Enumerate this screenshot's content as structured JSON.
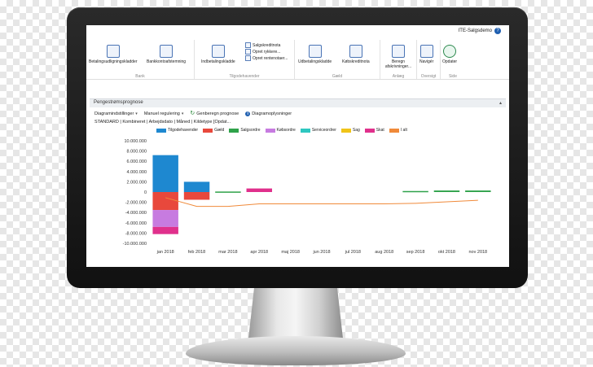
{
  "app": {
    "company": "ITE-Salgsdemo"
  },
  "ribbon": {
    "groups": [
      {
        "label": "Bank"
      },
      {
        "label": "Tilgodehavender"
      },
      {
        "label": "Gæld"
      },
      {
        "label": "Anlæg"
      },
      {
        "label": "Oversigt"
      },
      {
        "label": "Side"
      }
    ],
    "buttons": {
      "betalingsudligning": "Betalingsudligningskladder",
      "bankkonto": "Bankkontoafstemning",
      "indbetaling": "Indbetalingskladde",
      "salgskreditnota": "Salgskreditnota",
      "rykker": "Opret rykkere...",
      "rentenota": "Opret rentenotaer...",
      "udbetaling": "Udbetalingskladde",
      "kobskreditnota": "Købskreditnota",
      "beregn": "Beregn afskrivninger...",
      "naviger": "Navigér",
      "opdater": "Opdater"
    }
  },
  "part": {
    "title": "Pengestrømsprognose",
    "toolbar": {
      "diagramindstillinger": "Diagramindstillinger",
      "manuel": "Manuel regulering",
      "genberegn": "Genberegn prognose",
      "oplysninger": "Diagramoplysninger"
    },
    "filter": "STANDARD | Kombineret | Arbejdsdato | Måned | Kildetype [Opdat..."
  },
  "colors": {
    "accent": "#1f5fb0",
    "ribbon_icon": "#4a74b5"
  },
  "chart_data": {
    "type": "bar",
    "stacked": true,
    "categories": [
      "jan 2018",
      "feb 2018",
      "mar 2018",
      "apr 2018",
      "maj 2018",
      "jun 2018",
      "jul 2018",
      "aug 2018",
      "sep 2018",
      "okt 2018",
      "nov 2018"
    ],
    "ylim": [
      -10000000,
      10000000
    ],
    "yticks": [
      10000000,
      8000000,
      6000000,
      4000000,
      2000000,
      0,
      -2000000,
      -4000000,
      -6000000,
      -8000000,
      -10000000
    ],
    "ytick_labels": [
      "10.000.000",
      "8.000.000",
      "6.000.000",
      "4.000.000",
      "2.000.000",
      "0",
      "-2.000.000",
      "-4.000.000",
      "-6.000.000",
      "-8.000.000",
      "-10.000.000"
    ],
    "series": [
      {
        "name": "Tilgodehavender",
        "color": "#1e88d0",
        "values": [
          7200000,
          2000000,
          0,
          0,
          0,
          0,
          0,
          0,
          0,
          0,
          0
        ]
      },
      {
        "name": "Gæld",
        "color": "#e8483c",
        "values": [
          -3500000,
          -1500000,
          0,
          0,
          0,
          0,
          0,
          0,
          0,
          0,
          0
        ]
      },
      {
        "name": "Salgsordre",
        "color": "#2fa24a",
        "values": [
          0,
          0,
          100000,
          0,
          0,
          0,
          0,
          0,
          200000,
          300000,
          300000
        ]
      },
      {
        "name": "Købsordre",
        "color": "#c77be0",
        "values": [
          -3300000,
          0,
          0,
          0,
          0,
          0,
          0,
          0,
          0,
          0,
          0
        ]
      },
      {
        "name": "Serviceordrer",
        "color": "#2ec7c0",
        "values": [
          0,
          0,
          0,
          0,
          0,
          0,
          0,
          0,
          0,
          0,
          0
        ]
      },
      {
        "name": "Sag",
        "color": "#f0c419",
        "values": [
          0,
          0,
          0,
          0,
          0,
          0,
          0,
          0,
          0,
          0,
          0
        ]
      },
      {
        "name": "Skat",
        "color": "#e0308c",
        "values": [
          -1400000,
          0,
          0,
          700000,
          0,
          0,
          0,
          0,
          0,
          0,
          0
        ]
      },
      {
        "name": "I alt",
        "color": "#f08a3a",
        "type": "line",
        "values": [
          -1100000,
          -2800000,
          -2800000,
          -2300000,
          -2300000,
          -2300000,
          -2300000,
          -2300000,
          -2200000,
          -1900000,
          -1600000
        ]
      }
    ]
  }
}
